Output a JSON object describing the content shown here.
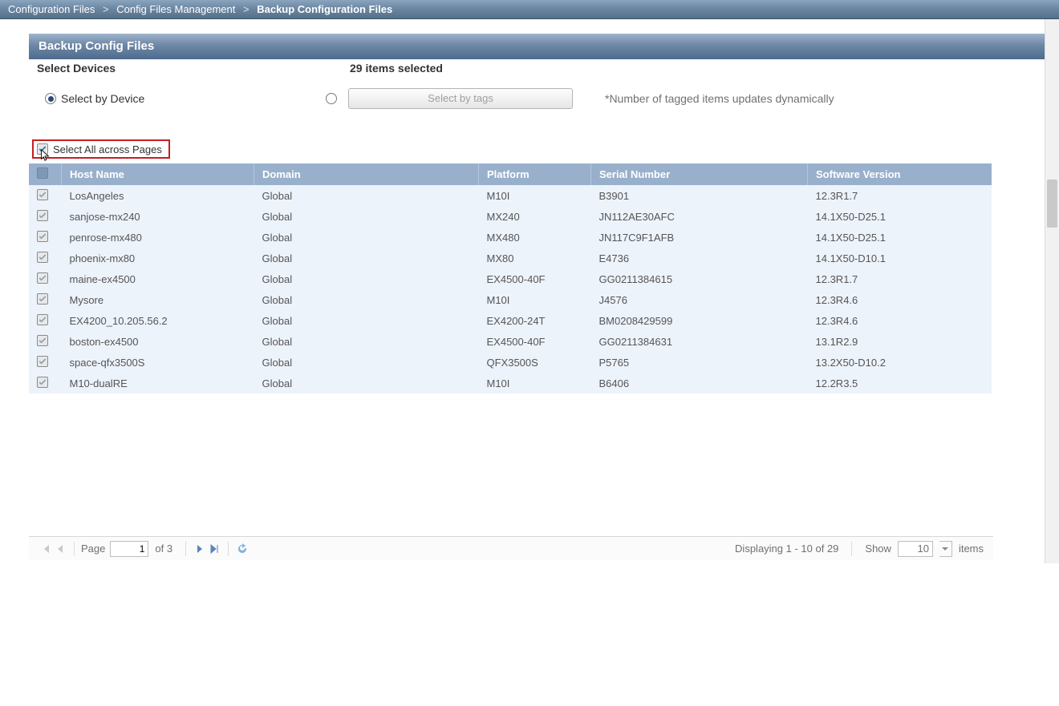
{
  "breadcrumb": {
    "items": [
      "Configuration Files",
      "Config Files Management",
      "Backup Configuration Files"
    ]
  },
  "panel": {
    "title": "Backup Config Files"
  },
  "subhead": {
    "select_devices": "Select Devices",
    "items_selected": "29 items selected"
  },
  "selectors": {
    "by_device": "Select by Device",
    "by_tags_btn": "Select by tags",
    "hint": "*Number of tagged items updates dynamically"
  },
  "select_all": {
    "label": "Select All across Pages"
  },
  "grid": {
    "headers": {
      "host": "Host Name",
      "domain": "Domain",
      "platform": "Platform",
      "serial": "Serial Number",
      "version": "Software Version"
    },
    "rows": [
      {
        "host": "LosAngeles",
        "domain": "Global",
        "platform": "M10I",
        "serial": "B3901",
        "version": "12.3R1.7"
      },
      {
        "host": "sanjose-mx240",
        "domain": "Global",
        "platform": "MX240",
        "serial": "JN112AE30AFC",
        "version": "14.1X50-D25.1"
      },
      {
        "host": "penrose-mx480",
        "domain": "Global",
        "platform": "MX480",
        "serial": "JN117C9F1AFB",
        "version": "14.1X50-D25.1"
      },
      {
        "host": "phoenix-mx80",
        "domain": "Global",
        "platform": "MX80",
        "serial": "E4736",
        "version": "14.1X50-D10.1"
      },
      {
        "host": "maine-ex4500",
        "domain": "Global",
        "platform": "EX4500-40F",
        "serial": "GG0211384615",
        "version": "12.3R1.7"
      },
      {
        "host": "Mysore",
        "domain": "Global",
        "platform": "M10I",
        "serial": "J4576",
        "version": "12.3R4.6"
      },
      {
        "host": "EX4200_10.205.56.2",
        "domain": "Global",
        "platform": "EX4200-24T",
        "serial": "BM0208429599",
        "version": "12.3R4.6"
      },
      {
        "host": "boston-ex4500",
        "domain": "Global",
        "platform": "EX4500-40F",
        "serial": "GG0211384631",
        "version": "13.1R2.9"
      },
      {
        "host": "space-qfx3500S",
        "domain": "Global",
        "platform": "QFX3500S",
        "serial": "P5765",
        "version": "13.2X50-D10.2"
      },
      {
        "host": "M10-dualRE",
        "domain": "Global",
        "platform": "M10I",
        "serial": "B6406",
        "version": "12.2R3.5"
      }
    ]
  },
  "pager": {
    "page_label": "Page",
    "page_value": "1",
    "total_label": "of 3",
    "displaying": "Displaying 1 - 10 of 29",
    "show_label": "Show",
    "show_value": "10",
    "items_label": "items"
  }
}
